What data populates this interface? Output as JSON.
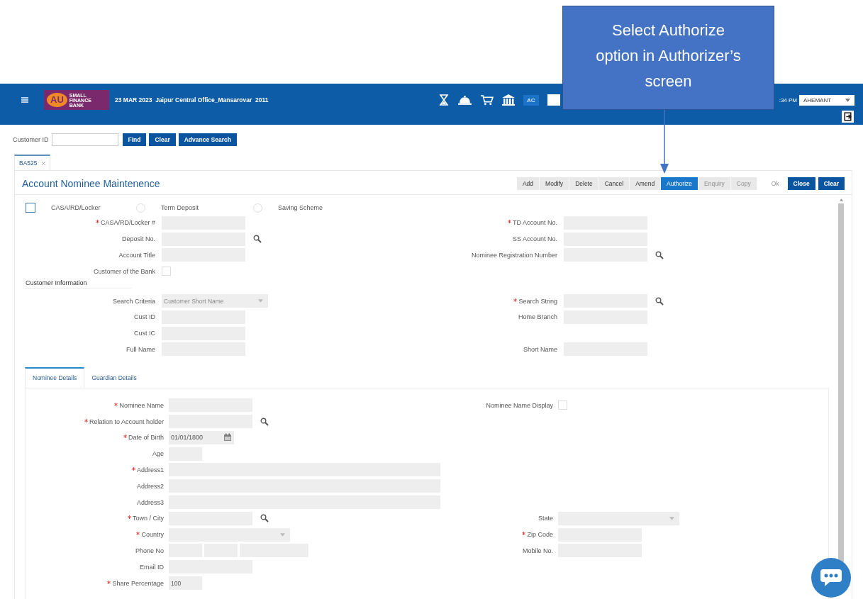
{
  "callout": {
    "text": "Select Authorize option in Authorizer’s screen"
  },
  "header": {
    "logo": {
      "mark": "AU",
      "name": "SMALL FINANCE BANK"
    },
    "info": "23 MAR 2023  Jaipur Central Office_Mansarovar  2011",
    "badge": "AC",
    "time": ":34 PM",
    "user": "AHEMANT"
  },
  "customer_search": {
    "label": "Customer ID",
    "buttons": [
      "Find",
      "Clear",
      "Advance Search"
    ]
  },
  "tabs": [
    {
      "label": "BA525",
      "selected": true
    }
  ],
  "panel": {
    "title": "Account Nominee Maintenence",
    "toolbar": [
      {
        "label": "Add",
        "kind": "group",
        "selected": false,
        "disabled": false
      },
      {
        "label": "Modify",
        "kind": "group",
        "selected": false,
        "disabled": false
      },
      {
        "label": "Delete",
        "kind": "group",
        "selected": false,
        "disabled": false
      },
      {
        "label": "Cancel",
        "kind": "group",
        "selected": false,
        "disabled": false
      },
      {
        "label": "Amend",
        "kind": "group",
        "selected": false,
        "disabled": false
      },
      {
        "label": "Authorize",
        "kind": "group",
        "selected": true,
        "disabled": false
      },
      {
        "label": "Enquiry",
        "kind": "group",
        "selected": false,
        "disabled": true
      },
      {
        "label": "Copy",
        "kind": "group",
        "selected": false,
        "disabled": true
      },
      {
        "label": "Ok",
        "kind": "plain",
        "selected": false,
        "disabled": true
      },
      {
        "label": "Close",
        "kind": "primary",
        "selected": false,
        "disabled": false
      },
      {
        "label": "Clear",
        "kind": "primary",
        "selected": false,
        "disabled": false
      }
    ],
    "types": [
      {
        "label": "CASA/RD/Locker",
        "kind": "checkbox",
        "checked": false
      },
      {
        "label": "Term Deposit",
        "kind": "radio",
        "checked": false
      },
      {
        "label": "Saving Scheme",
        "kind": "radio",
        "checked": false
      }
    ],
    "account_rows": [
      {
        "left": {
          "label": "CASA/RD/Locker #",
          "required": true,
          "kind": "text"
        },
        "right": {
          "label": "TD Account No.",
          "required": true,
          "kind": "text"
        }
      },
      {
        "left": {
          "label": "Deposit No.",
          "required": false,
          "kind": "search"
        },
        "right": {
          "label": "SS Account No.",
          "required": false,
          "kind": "text"
        }
      },
      {
        "left": {
          "label": "Account Title",
          "required": false,
          "kind": "text"
        },
        "right": {
          "label": "Nominee Registration Number",
          "required": false,
          "kind": "search"
        }
      },
      {
        "left": {
          "label": "Customer of the Bank",
          "required": false,
          "kind": "checkbox",
          "checked": false
        }
      }
    ],
    "customer_information": {
      "title": "Customer Information",
      "rows": [
        {
          "left": {
            "label": "Search Criteria",
            "required": false,
            "kind": "select",
            "placeholder": "Customer Short Name"
          },
          "right": {
            "label": "Search String",
            "required": true,
            "kind": "search"
          }
        },
        {
          "left": {
            "label": "Cust ID",
            "required": false,
            "kind": "text"
          },
          "right": {
            "label": "Home Branch",
            "required": false,
            "kind": "text"
          }
        },
        {
          "left": {
            "label": "Cust IC",
            "required": false,
            "kind": "text"
          }
        },
        {
          "left": {
            "label": "Full Name",
            "required": false,
            "kind": "text"
          },
          "right": {
            "label": "Short Name",
            "required": false,
            "kind": "text"
          }
        }
      ]
    },
    "detail_tabs": [
      {
        "label": "Nominee Details",
        "selected": true
      },
      {
        "label": "Guardian Details",
        "selected": false
      }
    ],
    "nominee_rows": [
      {
        "left": {
          "label": "Nominee Name",
          "required": true,
          "kind": "text"
        },
        "right": {
          "label": "Nominee Name Display",
          "required": false,
          "kind": "checkbox",
          "checked": false
        }
      },
      {
        "left": {
          "label": "Relation to Account holder",
          "required": true,
          "kind": "search"
        }
      },
      {
        "left": {
          "label": "Date of Birth",
          "required": true,
          "kind": "date",
          "value": "01/01/1800"
        }
      },
      {
        "left": {
          "label": "Age",
          "required": false,
          "kind": "small"
        }
      },
      {
        "left": {
          "label": "Address1",
          "required": true,
          "kind": "wide"
        }
      },
      {
        "left": {
          "label": "Address2",
          "required": false,
          "kind": "wide"
        }
      },
      {
        "left": {
          "label": "Address3",
          "required": false,
          "kind": "wide"
        }
      },
      {
        "left": {
          "label": "Town / City",
          "required": true,
          "kind": "search"
        },
        "right": {
          "label": "State",
          "required": false,
          "kind": "select"
        }
      },
      {
        "left": {
          "label": "Country",
          "required": true,
          "kind": "select"
        },
        "right": {
          "label": "Zip Code",
          "required": true,
          "kind": "text"
        }
      },
      {
        "left": {
          "label": "Phone No",
          "required": false,
          "kind": "phone"
        },
        "right": {
          "label": "Mobile No.",
          "required": false,
          "kind": "text"
        }
      },
      {
        "left": {
          "label": "Email ID",
          "required": false,
          "kind": "text"
        }
      },
      {
        "left": {
          "label": "Share Percentage",
          "required": true,
          "kind": "small",
          "value": "100"
        }
      }
    ]
  }
}
